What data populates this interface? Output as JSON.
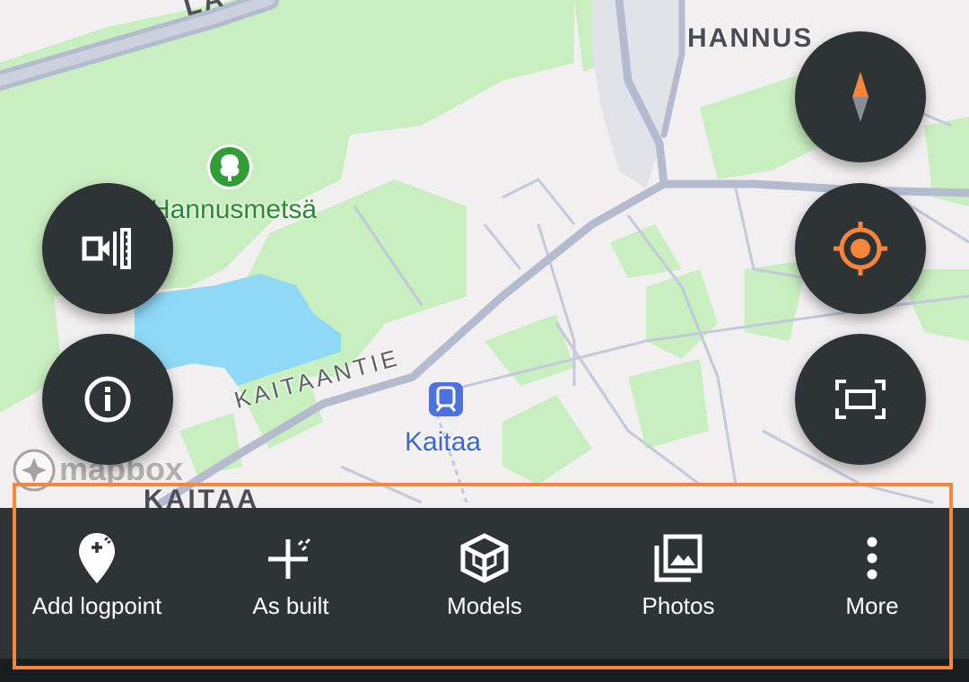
{
  "map": {
    "labels": {
      "district_north": "HANNUS",
      "district_south": "KAITAA",
      "park": "Hannusmetsä",
      "road": "KAITAANTIE",
      "station": "Kaitaa",
      "road_partial": "LÄ"
    },
    "attribution": "mapbox",
    "colors": {
      "land": "#f2eff0",
      "green": "#c9eec0",
      "water": "#8fd8f6",
      "road": "#b9c0d6",
      "major_road": "#b4bbcf"
    }
  },
  "controls": {
    "measure_icon": "measure-distance-icon",
    "info_icon": "info-icon",
    "compass_icon": "compass-icon",
    "locate_icon": "my-location-icon",
    "fit_icon": "fit-view-icon",
    "accent": "#f7853b"
  },
  "toolbar": {
    "items": [
      {
        "label": "Add logpoint",
        "icon": "add-logpoint-icon"
      },
      {
        "label": "As built",
        "icon": "as-built-icon"
      },
      {
        "label": "Models",
        "icon": "models-icon"
      },
      {
        "label": "Photos",
        "icon": "photos-icon"
      },
      {
        "label": "More",
        "icon": "more-icon"
      }
    ],
    "background": "#2e3336",
    "highlight_color": "#f7853b"
  }
}
